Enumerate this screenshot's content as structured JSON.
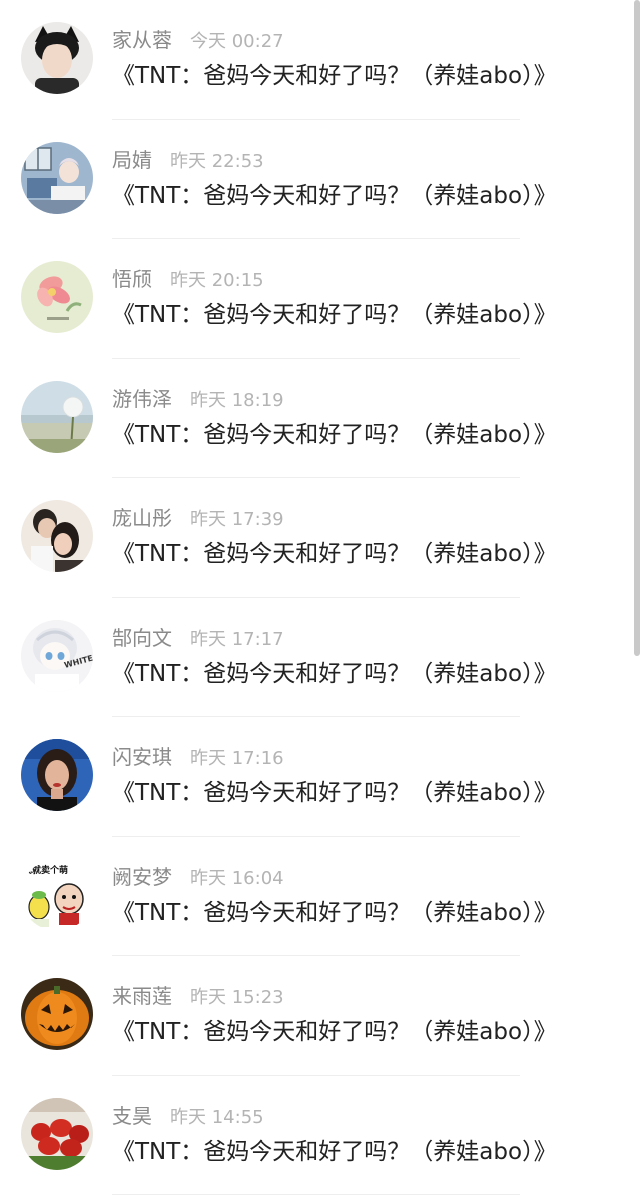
{
  "comments": [
    {
      "name": "家从蓉",
      "time": "今天 00:27",
      "text": "《TNT：爸妈今天和好了吗？（养娃abo）》",
      "avatar": "avatar-boy-icon"
    },
    {
      "name": "局婧",
      "time": "昨天 22:53",
      "text": "《TNT：爸妈今天和好了吗？（养娃abo）》",
      "avatar": "avatar-anime-room-icon"
    },
    {
      "name": "悟颀",
      "time": "昨天 20:15",
      "text": "《TNT：爸妈今天和好了吗？（养娃abo）》",
      "avatar": "avatar-flower-icon"
    },
    {
      "name": "游伟泽",
      "time": "昨天 18:19",
      "text": "《TNT：爸妈今天和好了吗？（养娃abo）》",
      "avatar": "avatar-dandelion-icon"
    },
    {
      "name": "庞山彤",
      "time": "昨天 17:39",
      "text": "《TNT：爸妈今天和好了吗？（养娃abo）》",
      "avatar": "avatar-couple-icon"
    },
    {
      "name": "郜向文",
      "time": "昨天 17:17",
      "text": "《TNT：爸妈今天和好了吗？（养娃abo）》",
      "avatar": "avatar-anime-white-icon"
    },
    {
      "name": "闪安琪",
      "time": "昨天 17:16",
      "text": "《TNT：爸妈今天和好了吗？（养娃abo）》",
      "avatar": "avatar-woman-icon"
    },
    {
      "name": "阙安梦",
      "time": "昨天 16:04",
      "text": "《TNT：爸妈今天和好了吗？（养娃abo）》",
      "avatar": "avatar-cartoon-icon"
    },
    {
      "name": "来雨莲",
      "time": "昨天 15:23",
      "text": "《TNT：爸妈今天和好了吗？（养娃abo）》",
      "avatar": "avatar-pumpkin-icon"
    },
    {
      "name": "支昊",
      "time": "昨天 14:55",
      "text": "《TNT：爸妈今天和好了吗？（养娃abo）》",
      "avatar": "avatar-food-icon"
    }
  ],
  "avatar_art": {
    "avatar-cartoon-icon": "成就卖个萌",
    "avatar-anime-white-icon": "WHITE"
  },
  "colors": {
    "name": "#8a8a8a",
    "time": "#b4b4b4",
    "message": "#222222",
    "divider": "#eeeeee"
  }
}
